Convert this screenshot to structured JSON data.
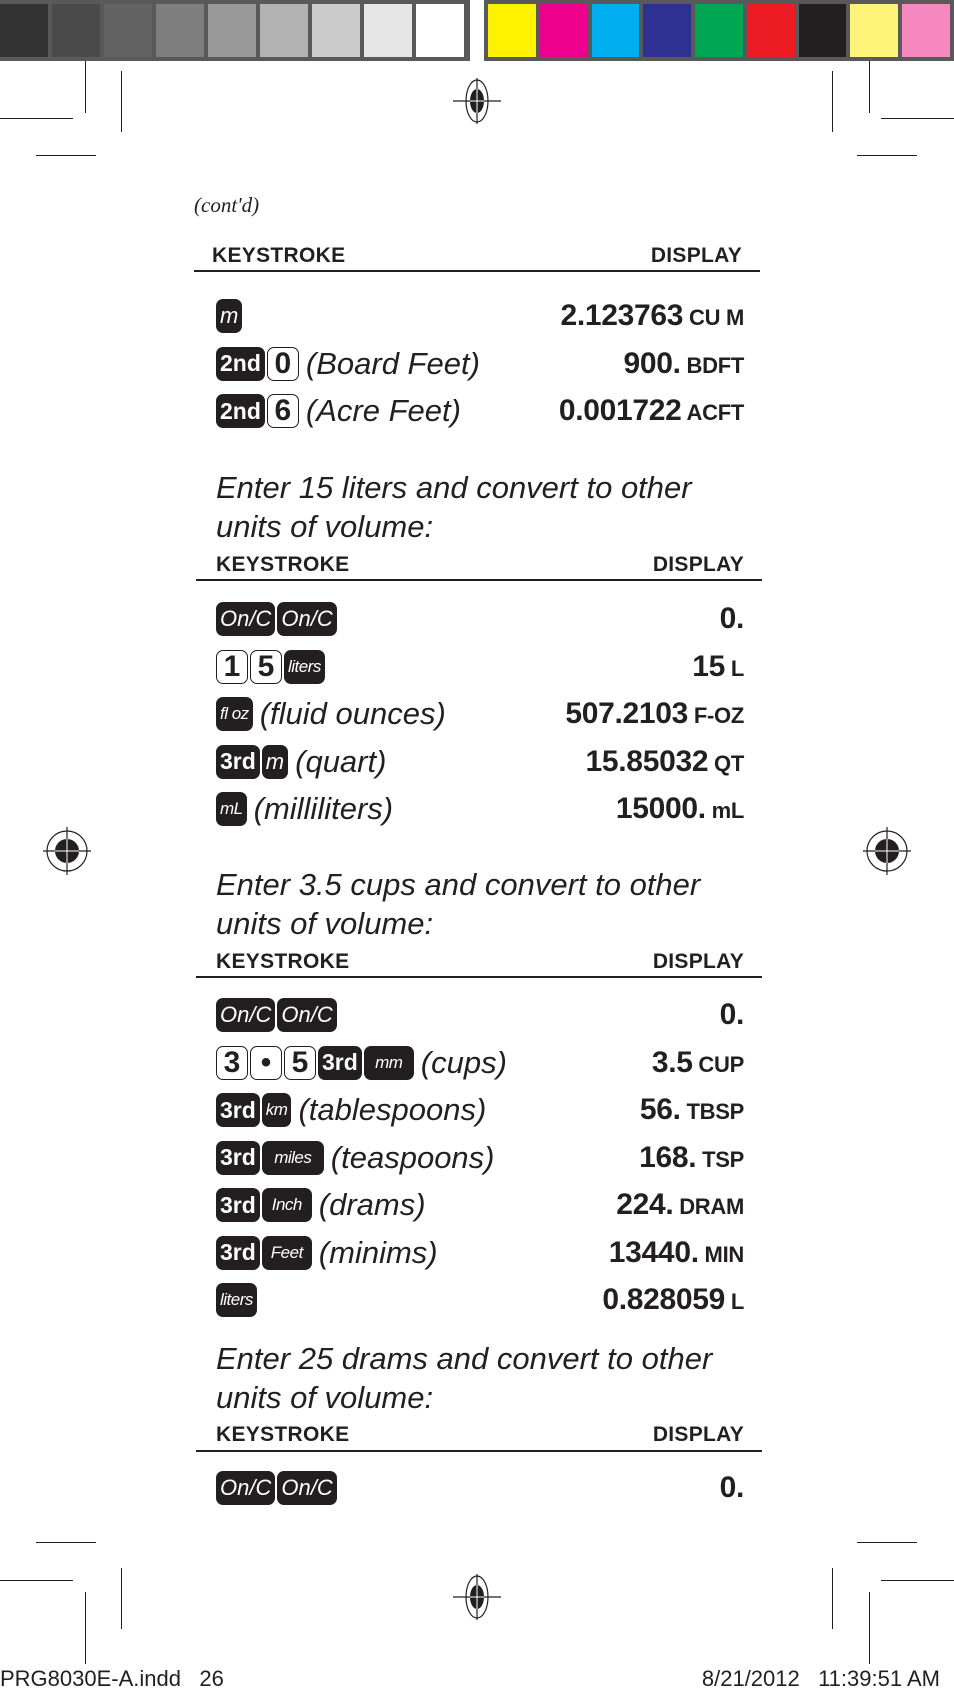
{
  "color_bar": {
    "grays": [
      "#333333",
      "#4a4a4a",
      "#636363",
      "#7f7f7f",
      "#999999",
      "#b2b2b2",
      "#cccccc",
      "#e6e6e6",
      "#ffffff"
    ],
    "colors": [
      "#fff200",
      "#ec008c",
      "#00aeef",
      "#2e3192",
      "#00a651",
      "#ed1c24",
      "#231f20",
      "#fff47a",
      "#f68ac0"
    ]
  },
  "page": {
    "contd": "(cont'd)",
    "keystroke_header": "KEYSTROKE",
    "display_header": "DISPLAY"
  },
  "section0": {
    "rows": [
      {
        "keys": [
          "m"
        ],
        "note": "",
        "value": "2.123763",
        "unit": "CU M"
      },
      {
        "keys": [
          "2nd",
          "0"
        ],
        "note": "(Board Feet)",
        "value": "900.",
        "unit": "BDFT"
      },
      {
        "keys": [
          "2nd",
          "6"
        ],
        "note": "(Acre Feet)",
        "value": "0.001722",
        "unit": "ACFT"
      }
    ]
  },
  "section1": {
    "intro_line1": "Enter 15 liters and convert to other",
    "intro_line2": "units of volume:",
    "rows": [
      {
        "keys": [
          "On/C",
          "On/C"
        ],
        "note": "",
        "value": "0.",
        "unit": ""
      },
      {
        "keys": [
          "1",
          "5",
          "liters"
        ],
        "note": "",
        "value": "15",
        "unit": "L"
      },
      {
        "keys": [
          "fl oz"
        ],
        "note": "(fluid ounces)",
        "value": "507.2103",
        "unit": "F-OZ"
      },
      {
        "keys": [
          "3rd",
          "m"
        ],
        "note": "(quart)",
        "value": "15.85032",
        "unit": "QT"
      },
      {
        "keys": [
          "mL"
        ],
        "note": "(milliliters)",
        "value": "15000.",
        "unit": "mL"
      }
    ]
  },
  "section2": {
    "intro_line1": "Enter 3.5 cups and convert to other",
    "intro_line2": "units of volume:",
    "rows": [
      {
        "keys": [
          "On/C",
          "On/C"
        ],
        "note": "",
        "value": "0.",
        "unit": ""
      },
      {
        "keys": [
          "3",
          "•",
          "5",
          "3rd",
          "mm"
        ],
        "note": "(cups)",
        "value": "3.5",
        "unit": "CUP"
      },
      {
        "keys": [
          "3rd",
          "km"
        ],
        "note": "(tablespoons)",
        "value": "56.",
        "unit": "TBSP"
      },
      {
        "keys": [
          "3rd",
          "miles"
        ],
        "note": "(teaspoons)",
        "value": "168.",
        "unit": "TSP"
      },
      {
        "keys": [
          "3rd",
          "Inch"
        ],
        "note": "(drams)",
        "value": "224.",
        "unit": "DRAM"
      },
      {
        "keys": [
          "3rd",
          "Feet"
        ],
        "note": "(minims)",
        "value": "13440.",
        "unit": "MIN"
      },
      {
        "keys": [
          "liters"
        ],
        "note": "",
        "value": "0.828059",
        "unit": "L"
      }
    ]
  },
  "section3": {
    "intro_line1": "Enter 25 drams and convert to other",
    "intro_line2": "units of volume:",
    "rows": [
      {
        "keys": [
          "On/C",
          "On/C"
        ],
        "note": "",
        "value": "0.",
        "unit": ""
      }
    ]
  },
  "footer": {
    "file": "PRG8030E-A.indd   26",
    "timestamp": "8/21/2012   11:39:51 AM"
  }
}
